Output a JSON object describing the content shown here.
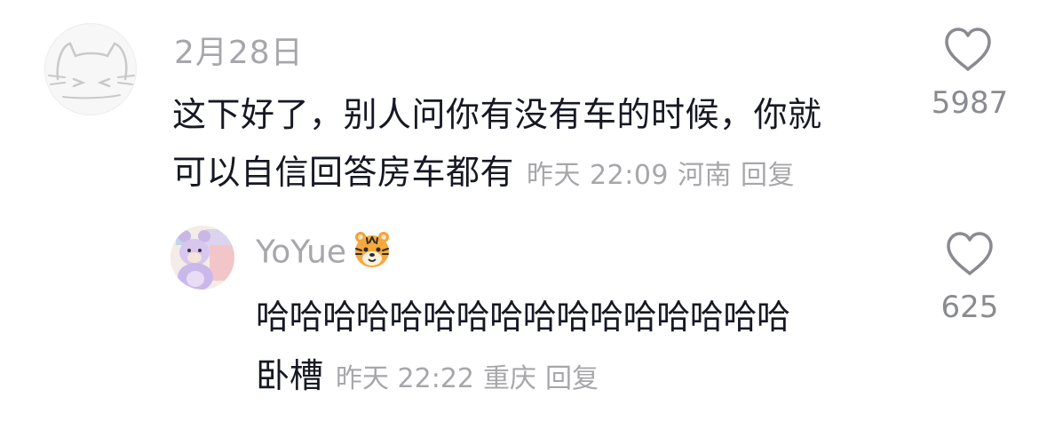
{
  "comments": [
    {
      "author": "2月28日",
      "avatar_icon": "cat-doodle-avatar",
      "text_line1": "这下好了，别人问你有没有车的时候，你就",
      "text_line2": "可以自信回答房车都有",
      "time": "昨天 22:09",
      "location": "河南",
      "reply_label": "回复",
      "likes": "5987"
    }
  ],
  "replies": [
    {
      "author": "YoYue",
      "author_emoji": "tiger-face-emoji",
      "avatar_icon": "bear-toy-avatar",
      "text_line1": "哈哈哈哈哈哈哈哈哈哈哈哈哈哈哈哈",
      "text_line2": "卧槽",
      "time": "昨天 22:22",
      "location": "重庆",
      "reply_label": "回复",
      "likes": "625"
    }
  ],
  "colors": {
    "primary_text": "#161823",
    "secondary_text": "#a7a7ab",
    "like_count": "#8a8b91",
    "background": "#ffffff"
  }
}
